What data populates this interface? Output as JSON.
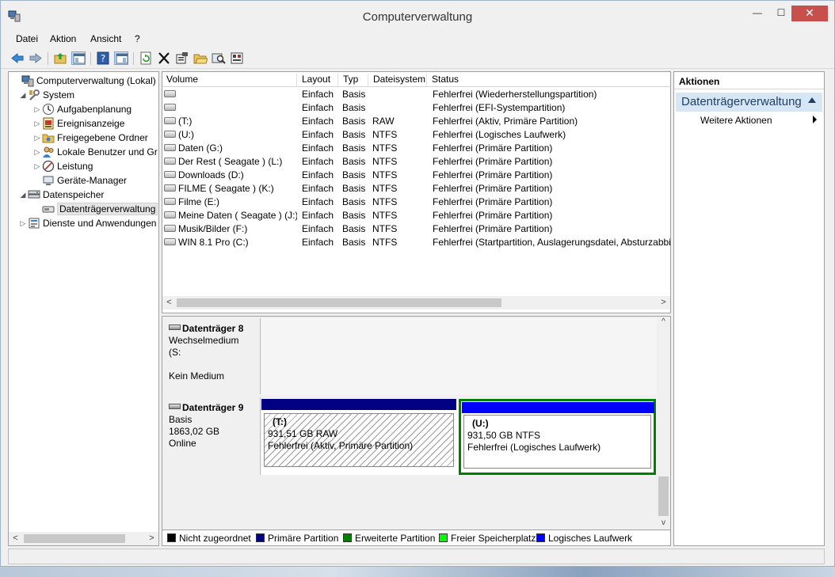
{
  "window": {
    "title": "Computerverwaltung",
    "min_label": "—",
    "max_label": "☐",
    "close_label": "✕"
  },
  "menu": [
    "Datei",
    "Aktion",
    "Ansicht",
    "?"
  ],
  "tree": [
    {
      "label": "Computerverwaltung (Lokal)",
      "expander": "",
      "icon": "computer-management-icon",
      "level": 0
    },
    {
      "label": "System",
      "expander": "◢",
      "icon": "system-tools-icon",
      "level": 1
    },
    {
      "label": "Aufgabenplanung",
      "expander": "▷",
      "icon": "task-scheduler-icon",
      "level": 2
    },
    {
      "label": "Ereignisanzeige",
      "expander": "▷",
      "icon": "event-viewer-icon",
      "level": 2
    },
    {
      "label": "Freigegebene Ordner",
      "expander": "▷",
      "icon": "shared-folders-icon",
      "level": 2
    },
    {
      "label": "Lokale Benutzer und Gr",
      "expander": "▷",
      "icon": "local-users-icon",
      "level": 2
    },
    {
      "label": "Leistung",
      "expander": "▷",
      "icon": "performance-icon",
      "level": 2
    },
    {
      "label": "Geräte-Manager",
      "expander": "",
      "icon": "device-manager-icon",
      "level": 2
    },
    {
      "label": "Datenspeicher",
      "expander": "◢",
      "icon": "storage-icon",
      "level": 1
    },
    {
      "label": "Datenträgerverwaltung",
      "expander": "",
      "icon": "disk-management-icon",
      "level": 2,
      "selected": true
    },
    {
      "label": "Dienste und Anwendungen",
      "expander": "▷",
      "icon": "services-icon",
      "level": 1
    }
  ],
  "table": {
    "headers": [
      "Volume",
      "Layout",
      "Typ",
      "Dateisystem",
      "Status"
    ],
    "rows": [
      [
        "",
        "Einfach",
        "Basis",
        "",
        "Fehlerfrei (Wiederherstellungspartition)"
      ],
      [
        "",
        "Einfach",
        "Basis",
        "",
        "Fehlerfrei (EFI-Systempartition)"
      ],
      [
        "(T:)",
        "Einfach",
        "Basis",
        "RAW",
        "Fehlerfrei (Aktiv, Primäre Partition)"
      ],
      [
        "(U:)",
        "Einfach",
        "Basis",
        "NTFS",
        "Fehlerfrei (Logisches Laufwerk)"
      ],
      [
        "Daten (G:)",
        "Einfach",
        "Basis",
        "NTFS",
        "Fehlerfrei (Primäre Partition)"
      ],
      [
        "Der Rest ( Seagate )  (L:)",
        "Einfach",
        "Basis",
        "NTFS",
        "Fehlerfrei (Primäre Partition)"
      ],
      [
        "Downloads (D:)",
        "Einfach",
        "Basis",
        "NTFS",
        "Fehlerfrei (Primäre Partition)"
      ],
      [
        "FILME ( Seagate )  (K:)",
        "Einfach",
        "Basis",
        "NTFS",
        "Fehlerfrei (Primäre Partition)"
      ],
      [
        "Filme (E:)",
        "Einfach",
        "Basis",
        "NTFS",
        "Fehlerfrei (Primäre Partition)"
      ],
      [
        "Meine Daten ( Seagate )  (J:)",
        "Einfach",
        "Basis",
        "NTFS",
        "Fehlerfrei (Primäre Partition)"
      ],
      [
        "Musik/Bilder (F:)",
        "Einfach",
        "Basis",
        "NTFS",
        "Fehlerfrei (Primäre Partition)"
      ],
      [
        "WIN 8.1 Pro  (C:)",
        "Einfach",
        "Basis",
        "NTFS",
        "Fehlerfrei (Startpartition, Auslagerungsdatei, Absturzabbil"
      ]
    ]
  },
  "disks": {
    "disk8": {
      "name": "Datenträger 8",
      "line1": "Wechselmedium (S:",
      "line2": "Kein Medium"
    },
    "disk9": {
      "name": "Datenträger 9",
      "line1": "Basis",
      "line2": "1863,02 GB",
      "line3": "Online"
    },
    "partT": {
      "label": "(T:)",
      "size": "931,51 GB RAW",
      "status": "Fehlerfrei (Aktiv, Primäre Partition)"
    },
    "partU": {
      "label": "(U:)",
      "size": "931,50 GB NTFS",
      "status": "Fehlerfrei (Logisches Laufwerk)"
    }
  },
  "legend": [
    {
      "label": "Nicht zugeordnet",
      "color": "#000000"
    },
    {
      "label": "Primäre Partition",
      "color": "#000080"
    },
    {
      "label": "Erweiterte Partition",
      "color": "#008000"
    },
    {
      "label": "Freier Speicherplatz",
      "color": "#00ff00"
    },
    {
      "label": "Logisches Laufwerk",
      "color": "#0000ff"
    }
  ],
  "actions": {
    "header": "Aktionen",
    "section": "Datenträgerverwaltung",
    "more": "Weitere Aktionen"
  },
  "colors": {
    "primary_partition": "#000080",
    "logical_drive": "#0000ff",
    "extended_partition": "#008000",
    "selection_blue": "#d7e6f4"
  }
}
